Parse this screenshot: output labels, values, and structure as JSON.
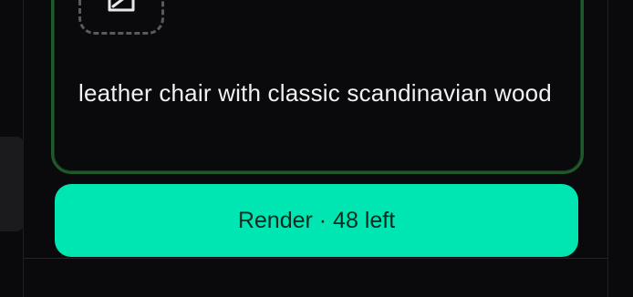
{
  "prompt": {
    "text": "leather chair with classic scandinavian wood",
    "image_slot_icon": "image-edit-icon"
  },
  "render_button": {
    "label": "Render · 48 left",
    "color": "#00e6b2"
  },
  "colors": {
    "background": "#0a0a0c",
    "card_border": "#1f5a2c",
    "text": "#f1f1f3"
  }
}
